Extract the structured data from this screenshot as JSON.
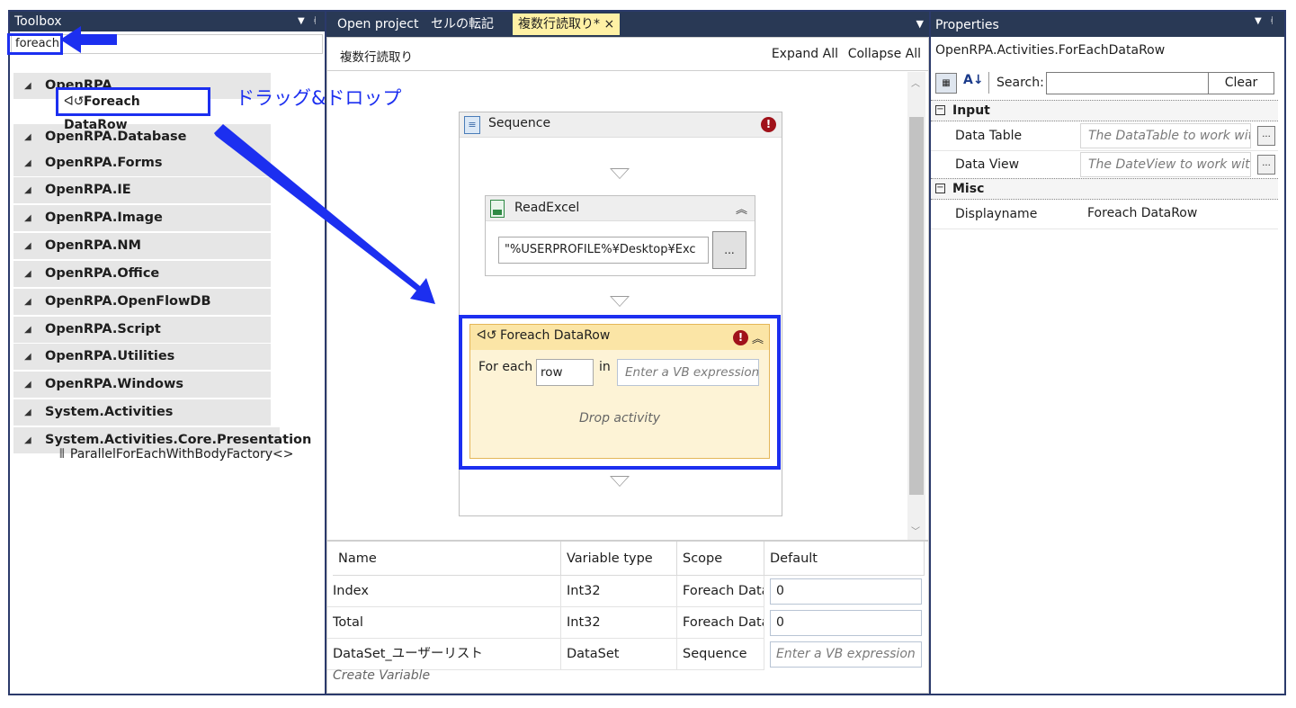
{
  "toolbox": {
    "title": "Toolbox",
    "search_value": "foreach",
    "categories": [
      "OpenRPA",
      "OpenRPA.Database",
      "OpenRPA.Forms",
      "OpenRPA.IE",
      "OpenRPA.Image",
      "OpenRPA.NM",
      "OpenRPA.Office",
      "OpenRPA.OpenFlowDB",
      "OpenRPA.Script",
      "OpenRPA.Utilities",
      "OpenRPA.Windows",
      "System.Activities",
      "System.Activities.Core.Presentation"
    ],
    "selected_item": "Foreach DataRow",
    "presentation_item": "ParallelForEachWithBodyFactory<>"
  },
  "annotation": {
    "drag_drop_label": "ドラッグ&ドロップ",
    "arrow_color": "#1c2ff0"
  },
  "tabs": [
    {
      "label": "Open project",
      "active": false
    },
    {
      "label": "セルの転記",
      "active": false
    },
    {
      "label": "複数行読取り*",
      "active": true,
      "close": "×"
    }
  ],
  "designer": {
    "breadcrumb": "複数行読取り",
    "expand_all": "Expand All",
    "collapse_all": "Collapse All",
    "sequence": {
      "title": "Sequence",
      "error_mark": "!",
      "read_excel": {
        "title": "ReadExcel",
        "path": "\"%USERPROFILE%¥Desktop¥Exc",
        "browse": "..."
      },
      "foreach": {
        "title": "Foreach DataRow",
        "for_each_label": "For each",
        "variable": "row",
        "in_label": "in",
        "expression_placeholder": "Enter a VB expression",
        "drop_hint": "Drop activity"
      }
    }
  },
  "variables": {
    "headers": [
      "Name",
      "Variable type",
      "Scope",
      "Default"
    ],
    "rows": [
      {
        "name": "Index",
        "type": "Int32",
        "scope": "Foreach DataRow",
        "default": "0",
        "placeholder": false
      },
      {
        "name": "Total",
        "type": "Int32",
        "scope": "Foreach DataRow",
        "default": "0",
        "placeholder": false
      },
      {
        "name": "DataSet_ユーザーリスト",
        "type": "DataSet",
        "scope": "Sequence",
        "default": "Enter a VB expression",
        "placeholder": true
      }
    ],
    "create": "Create Variable"
  },
  "properties": {
    "title": "Properties",
    "object": "OpenRPA.Activities.ForEachDataRow",
    "search_label": "Search:",
    "search_value": "",
    "clear": "Clear",
    "categories": [
      {
        "name": "Input",
        "rows": [
          {
            "name": "Data Table",
            "value": "The DataTable to work with",
            "placeholder": true
          },
          {
            "name": "Data View",
            "value": "The DateView to work with",
            "placeholder": true
          }
        ]
      },
      {
        "name": "Misc",
        "rows": [
          {
            "name": "Displayname",
            "value": "Foreach DataRow",
            "placeholder": false
          }
        ]
      }
    ]
  }
}
